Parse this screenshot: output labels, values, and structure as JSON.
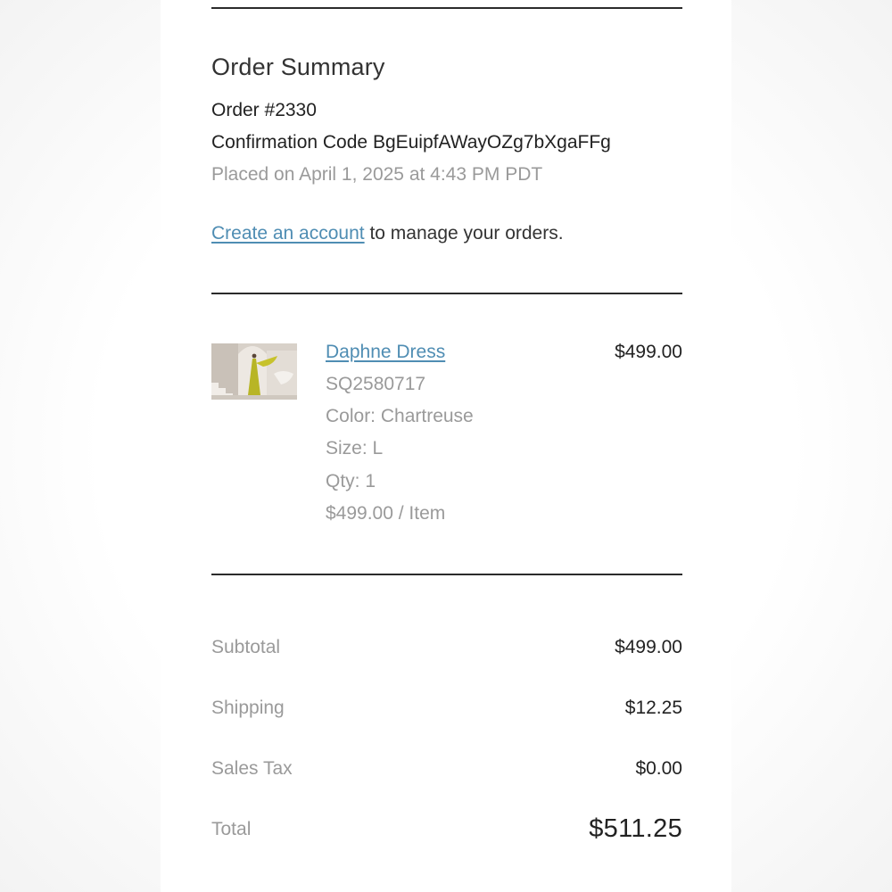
{
  "summary": {
    "title": "Order Summary",
    "order_number": "Order #2330",
    "confirmation_label": "Confirmation Code",
    "confirmation_code": "BgEuipfAWayOZg7bXgaFFg",
    "placed": "Placed on April 1, 2025 at 4:43 PM PDT",
    "create_account_link": "Create an account",
    "create_account_text": " to manage your orders."
  },
  "item": {
    "image_alt": "Daphne Dress product photo",
    "name": "Daphne Dress",
    "price": "$499.00",
    "sku": "SQ2580717",
    "color": "Color: Chartreuse",
    "size": "Size: L",
    "qty": "Qty: 1",
    "unit_price": "$499.00 / Item"
  },
  "totals": {
    "subtotal_label": "Subtotal",
    "subtotal_value": "$499.00",
    "shipping_label": "Shipping",
    "shipping_value": "$12.25",
    "tax_label": "Sales Tax",
    "tax_value": "$0.00",
    "total_label": "Total",
    "total_value": "$511.25"
  },
  "colors": {
    "link": "#4f8db3",
    "muted_text": "#9a9a9a",
    "text": "#222222",
    "divider": "#2b2b2b",
    "product_dress": "#b8b526"
  }
}
